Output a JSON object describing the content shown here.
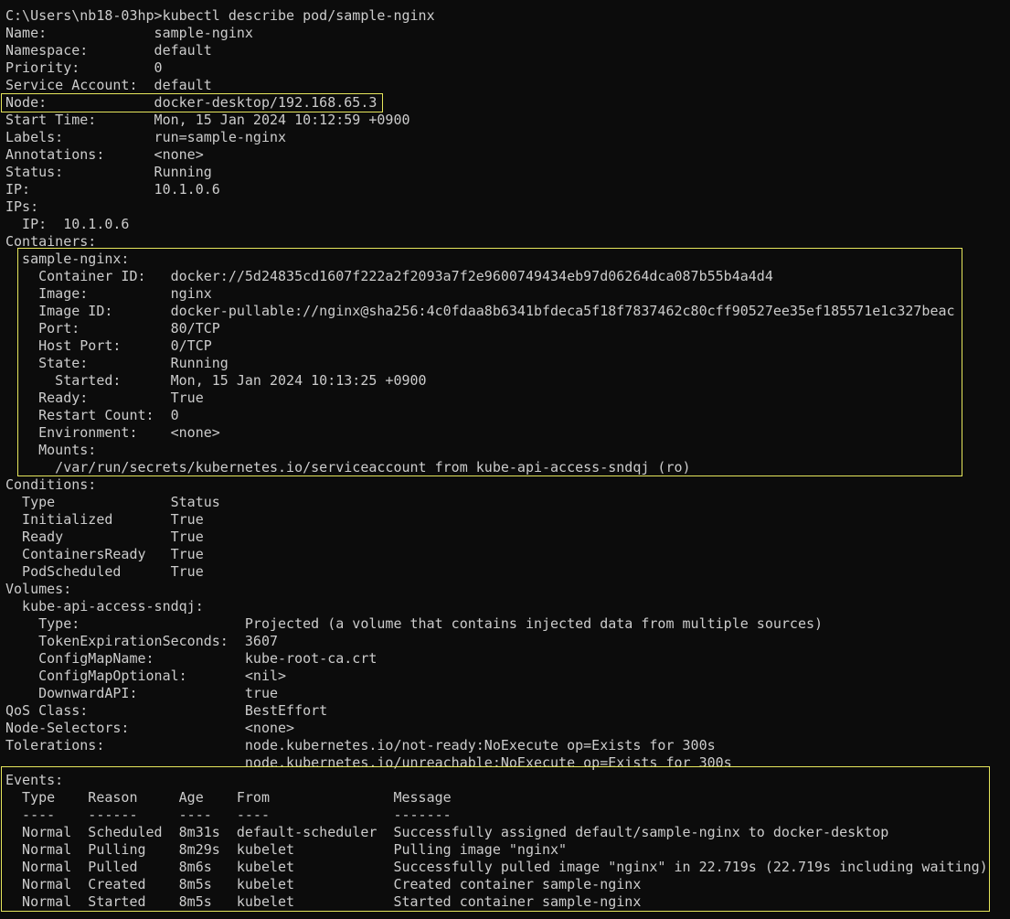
{
  "terminal": {
    "background": "#0c0c0c",
    "text_color": "#cccccc",
    "highlight_color": "#e6e65c",
    "lines": [
      "C:\\Users\\nb18-03hp>kubectl describe pod/sample-nginx",
      "Name:             sample-nginx",
      "Namespace:        default",
      "Priority:         0",
      "Service Account:  default",
      "Node:             docker-desktop/192.168.65.3",
      "Start Time:       Mon, 15 Jan 2024 10:12:59 +0900",
      "Labels:           run=sample-nginx",
      "Annotations:      <none>",
      "Status:           Running",
      "IP:               10.1.0.6",
      "IPs:",
      "  IP:  10.1.0.6",
      "Containers:",
      "  sample-nginx:",
      "    Container ID:   docker://5d24835cd1607f222a2f2093a7f2e9600749434eb97d06264dca087b55b4a4d4",
      "    Image:          nginx",
      "    Image ID:       docker-pullable://nginx@sha256:4c0fdaa8b6341bfdeca5f18f7837462c80cff90527ee35ef185571e1c327beac",
      "    Port:           80/TCP",
      "    Host Port:      0/TCP",
      "    State:          Running",
      "      Started:      Mon, 15 Jan 2024 10:13:25 +0900",
      "    Ready:          True",
      "    Restart Count:  0",
      "    Environment:    <none>",
      "    Mounts:",
      "      /var/run/secrets/kubernetes.io/serviceaccount from kube-api-access-sndqj (ro)",
      "Conditions:",
      "  Type              Status",
      "  Initialized       True",
      "  Ready             True",
      "  ContainersReady   True",
      "  PodScheduled      True",
      "Volumes:",
      "  kube-api-access-sndqj:",
      "    Type:                    Projected (a volume that contains injected data from multiple sources)",
      "    TokenExpirationSeconds:  3607",
      "    ConfigMapName:           kube-root-ca.crt",
      "    ConfigMapOptional:       <nil>",
      "    DownwardAPI:             true",
      "QoS Class:                   BestEffort",
      "Node-Selectors:              <none>",
      "Tolerations:                 node.kubernetes.io/not-ready:NoExecute op=Exists for 300s",
      "                             node.kubernetes.io/unreachable:NoExecute op=Exists for 300s",
      "Events:",
      "  Type    Reason     Age    From               Message",
      "  ----    ------     ----   ----               -------",
      "  Normal  Scheduled  8m31s  default-scheduler  Successfully assigned default/sample-nginx to docker-desktop",
      "  Normal  Pulling    8m29s  kubelet            Pulling image \"nginx\"",
      "  Normal  Pulled     8m6s   kubelet            Successfully pulled image \"nginx\" in 22.719s (22.719s including waiting)",
      "  Normal  Created    8m5s   kubelet            Created container sample-nginx",
      "  Normal  Started    8m5s   kubelet            Started container sample-nginx"
    ]
  }
}
